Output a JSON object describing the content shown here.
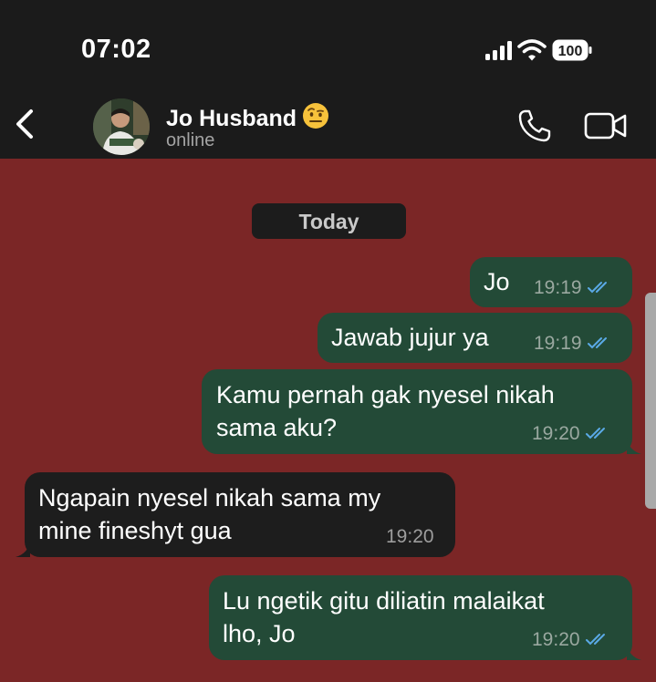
{
  "status_bar": {
    "time": "07:02",
    "battery": "100"
  },
  "header": {
    "contact_name": "Jo Husband",
    "contact_status": "online"
  },
  "date_separator": "Today",
  "messages": [
    {
      "direction": "outgoing",
      "text": "Jo",
      "time": "19:19",
      "read": true
    },
    {
      "direction": "outgoing",
      "text": "Jawab jujur ya",
      "time": "19:19",
      "read": true
    },
    {
      "direction": "outgoing",
      "lines": [
        "Kamu pernah gak nyesel nikah",
        "sama aku?"
      ],
      "time": "19:20",
      "read": true
    },
    {
      "direction": "incoming",
      "lines": [
        "Ngapain nyesel nikah sama my",
        "mine fineshyt gua"
      ],
      "time": "19:20"
    },
    {
      "direction": "outgoing",
      "lines": [
        "Lu ngetik gitu diliatin malaikat",
        "lho, Jo"
      ],
      "time": "19:20",
      "read": true
    }
  ],
  "colors": {
    "chat_background": "#7b2626",
    "outgoing_bubble": "#234a37",
    "incoming_bubble": "#1d1d1d",
    "read_ticks": "#5aa9e6"
  },
  "icons": [
    "back-chevron-icon",
    "phone-icon",
    "video-camera-icon",
    "raised-eyebrow-emoji-icon",
    "cellular-signal-icon",
    "wifi-icon",
    "battery-icon",
    "double-check-icon"
  ]
}
